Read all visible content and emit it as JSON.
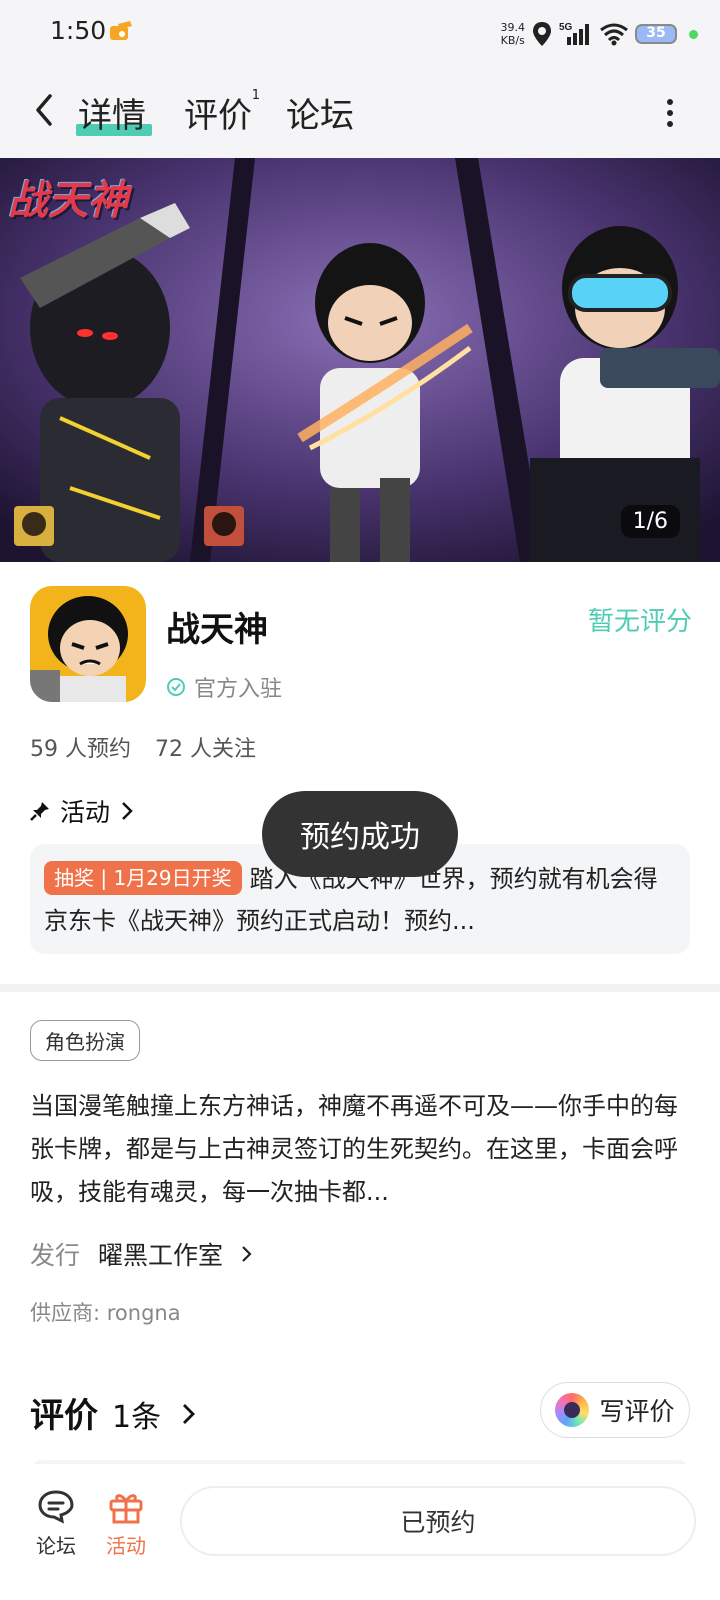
{
  "status_bar": {
    "time": "1:50",
    "net_speed_value": "39.4",
    "net_speed_unit": "KB/s",
    "network": "5G",
    "battery": "35"
  },
  "nav": {
    "tabs": [
      {
        "label": "详情",
        "active": true
      },
      {
        "label": "评价",
        "badge": "1"
      },
      {
        "label": "论坛"
      }
    ]
  },
  "banner": {
    "logo_text": "战天神",
    "counter": "1/6"
  },
  "app": {
    "name": "战天神",
    "rating": "暂无评分",
    "official_label": "官方入驻",
    "reservations": "59 人预约",
    "followers": "72 人关注"
  },
  "activity": {
    "heading": "活动",
    "tag": "抽奖 | 1月29日开奖",
    "text": "踏入《战天神》世界，预约就有机会得京东卡《战天神》预约正式启动！预约..."
  },
  "toast": "预约成功",
  "detail": {
    "genre": "角色扮演",
    "description": "当国漫笔触撞上东方神话，神魔不再遥不可及——你手中的每张卡牌，都是与上古神灵签订的生死契约。在这里，卡面会呼吸，技能有魂灵，每一次抽卡都...",
    "publisher_label": "发行",
    "publisher": "曜黑工作室",
    "supplier": "供应商: rongna"
  },
  "reviews": {
    "title": "评价",
    "count": "1条",
    "write_button": "写评价"
  },
  "bottom_bar": {
    "forum": "论坛",
    "activity": "活动",
    "reserve_button": "已预约"
  },
  "colors": {
    "accent": "#4ecdb4",
    "orange": "#f0724a",
    "toast_bg": "#333333"
  }
}
